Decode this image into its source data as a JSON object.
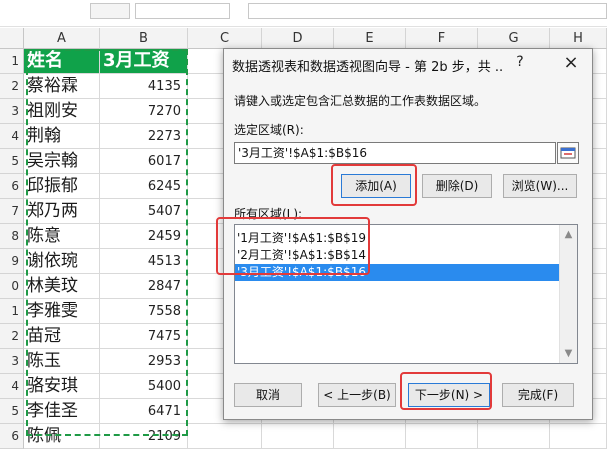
{
  "columns": [
    "A",
    "B",
    "C",
    "D",
    "E",
    "F",
    "G",
    "H"
  ],
  "rows": [
    "1",
    "2",
    "3",
    "4",
    "5",
    "6",
    "7",
    "8",
    "9",
    "0",
    "1",
    "2",
    "3",
    "4",
    "5",
    "6"
  ],
  "table": {
    "header": {
      "name": "姓名",
      "salary": "3月工资"
    },
    "body": [
      {
        "name": "蔡裕霖",
        "salary": "4135"
      },
      {
        "name": "祖刚安",
        "salary": "7270"
      },
      {
        "name": "荆翰",
        "salary": "2273"
      },
      {
        "name": "吴宗翰",
        "salary": "6017"
      },
      {
        "name": "邱振郁",
        "salary": "6245"
      },
      {
        "name": "郑乃两",
        "salary": "5407"
      },
      {
        "name": "陈意",
        "salary": "2459"
      },
      {
        "name": "谢依琬",
        "salary": "4513"
      },
      {
        "name": "林美玟",
        "salary": "2847"
      },
      {
        "name": "李雅雯",
        "salary": "7558"
      },
      {
        "name": "苗冠",
        "salary": "7475"
      },
      {
        "name": "陈玉",
        "salary": "2953"
      },
      {
        "name": "骆安琪",
        "salary": "5400"
      },
      {
        "name": "李佳圣",
        "salary": "6471"
      },
      {
        "name": "陈佩",
        "salary": "2109"
      }
    ]
  },
  "dialog": {
    "title": "数据透视表和数据透视图向导 - 第 2b 步，共 ...",
    "help": "?",
    "close": "×",
    "instruction": "请键入或选定包含汇总数据的工作表数据区域。",
    "range_label": "选定区域(R):",
    "range_value": "'3月工资'!$A$1:$B$16",
    "add_label": "添加(A)",
    "delete_label": "删除(D)",
    "browse_label": "浏览(W)...",
    "all_ranges_label": "所有区域(L):",
    "ranges": [
      "'1月工资'!$A$1:$B$19",
      "'2月工资'!$A$1:$B$14",
      "'3月工资'!$A$1:$B$16"
    ],
    "cancel_label": "取消",
    "back_label": "< 上一步(B)",
    "next_label": "下一步(N) >",
    "finish_label": "完成(F)"
  },
  "colors": {
    "header_green": "#10a24a",
    "selection_blue": "#2a8bee",
    "highlight_red": "#e23a3a"
  }
}
